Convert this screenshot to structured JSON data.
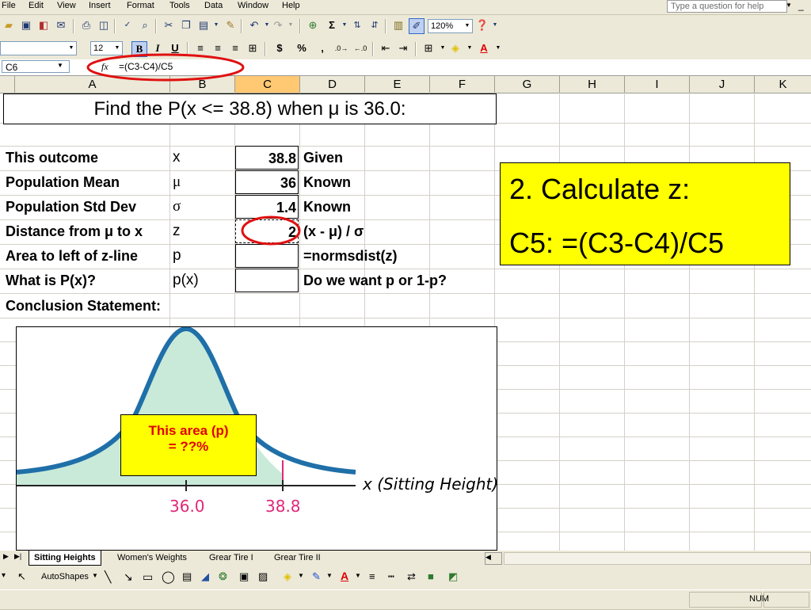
{
  "menubar": {
    "items": [
      "File",
      "Edit",
      "View",
      "Insert",
      "Format",
      "Tools",
      "Data",
      "Window",
      "Help"
    ],
    "ask_placeholder": "Type a question for help"
  },
  "toolbar": {
    "zoom": "120%",
    "font_size": "12",
    "bold": "B",
    "italic": "I",
    "underline": "U",
    "currency": "$",
    "percent": "%",
    "comma": ",",
    "sum": "Σ"
  },
  "formula_bar": {
    "name_box": "C6",
    "fx": "fx",
    "formula": "=(C3-C4)/C5"
  },
  "columns": [
    "A",
    "B",
    "C",
    "D",
    "E",
    "F",
    "G",
    "H",
    "I",
    "J",
    "K"
  ],
  "selected_column": "C",
  "sheet": {
    "title": "Find the P(x <= 38.8) when μ is 36.0:",
    "rows": [
      {
        "label": "This outcome",
        "symbol": "x",
        "value": "38.8",
        "note": "Given"
      },
      {
        "label": "Population Mean",
        "symbol": "μ",
        "value": "36",
        "note": "Known"
      },
      {
        "label": "Population Std Dev",
        "symbol": "σ",
        "value": "1.4",
        "note": "Known"
      },
      {
        "label": "Distance from μ to x",
        "symbol": "z",
        "value": "2",
        "note": "(x - μ) / σ"
      },
      {
        "label": "Area to left of z-line",
        "symbol": "p",
        "value": "",
        "note": "=normsdist(z)"
      },
      {
        "label": "What is P(x)?",
        "symbol": "p(x)",
        "value": "",
        "note": "Do we want p or 1-p?"
      }
    ],
    "conclusion_label": "Conclusion Statement:"
  },
  "callout": {
    "line1": "2. Calculate z:",
    "line2": "C5: =(C3-C4)/C5"
  },
  "chart": {
    "area_label_line1": "This area  (p)",
    "area_label_line2": "= ??%",
    "axis_label": "x (Sitting Height)",
    "tick_mean": "36.0",
    "tick_x": "38.8",
    "colors": {
      "curve": "#1f6fa8",
      "fill": "#c9ead9",
      "ticks": "#e0287a",
      "label_box": "#ffff00",
      "label_text": "#e00000"
    }
  },
  "sheet_tabs": {
    "active": "Sitting Heights",
    "others": [
      "Women's Weights",
      "Grear Tire I",
      "Grear Tire II"
    ]
  },
  "drawbar": {
    "autoshapes": "AutoShapes"
  },
  "status": {
    "num": "NUM"
  },
  "accent": {
    "oval": "#e01010",
    "selection_header": "#ffc873"
  }
}
